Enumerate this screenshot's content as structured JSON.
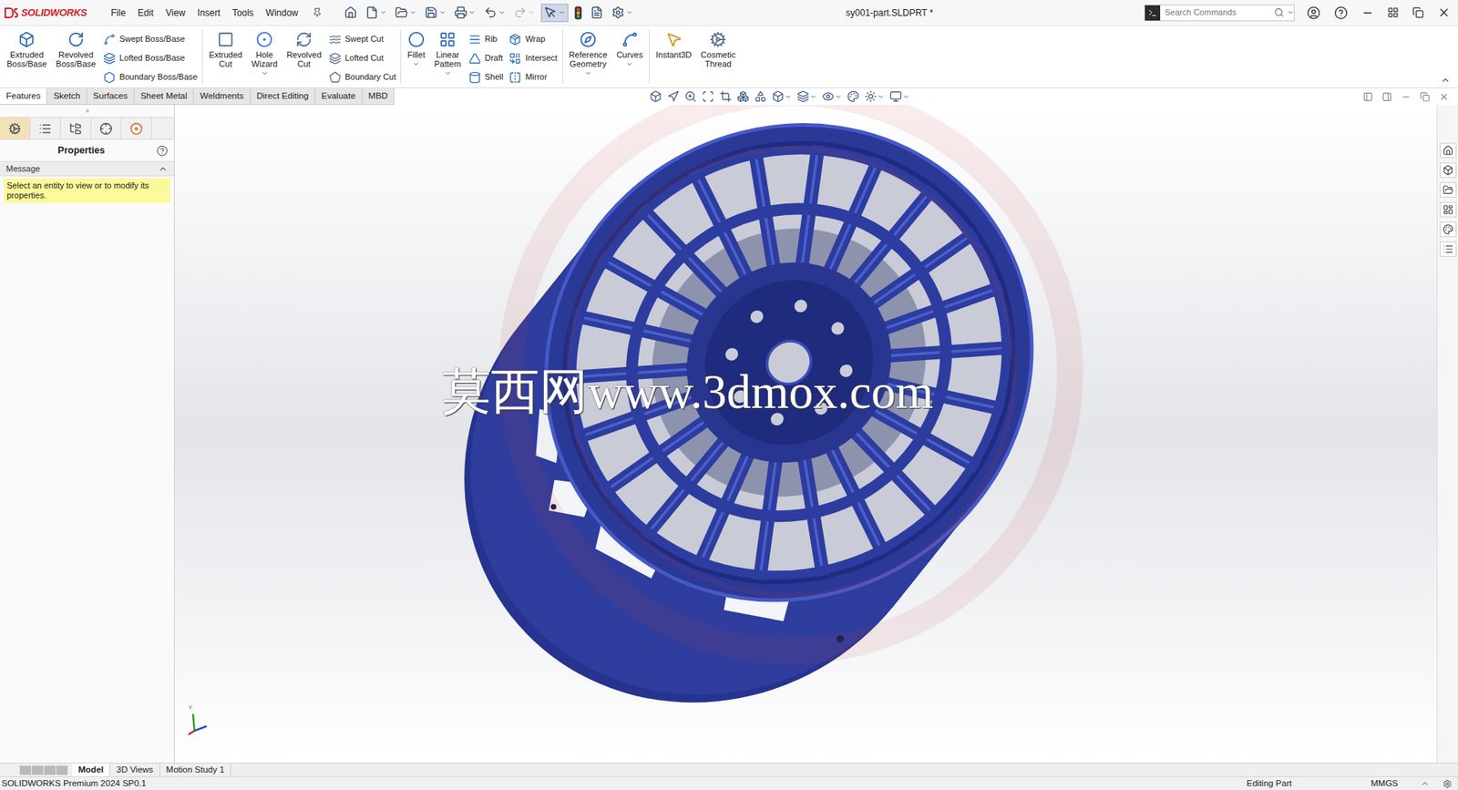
{
  "app": {
    "name": "SOLIDWORKS"
  },
  "menu": [
    "File",
    "Edit",
    "View",
    "Insert",
    "Tools",
    "Window"
  ],
  "toolbar": [
    {
      "dropdown": false,
      "selected": false,
      "disabled": false
    },
    {
      "dropdown": true,
      "selected": false,
      "disabled": false
    },
    {
      "dropdown": true,
      "selected": false,
      "disabled": false
    },
    {
      "dropdown": true,
      "selected": false,
      "disabled": false
    },
    {
      "dropdown": true,
      "selected": false,
      "disabled": false
    },
    {
      "dropdown": true,
      "selected": false,
      "disabled": false
    },
    {
      "dropdown": true,
      "selected": false,
      "disabled": true
    },
    {
      "dropdown": true,
      "selected": true,
      "disabled": false
    },
    {
      "dropdown": false,
      "selected": false,
      "disabled": false
    },
    {
      "dropdown": false,
      "selected": false,
      "disabled": false
    },
    {
      "dropdown": true,
      "selected": false,
      "disabled": false
    }
  ],
  "document": {
    "title": "sy001-part.SLDPRT *"
  },
  "search": {
    "placeholder": "Search Commands"
  },
  "ribbon": {
    "groups": [
      [
        {
          "kind": "large",
          "label": "Extruded Boss/Base",
          "dropdown": false
        },
        {
          "kind": "large",
          "label": "Revolved Boss/Base",
          "dropdown": false
        },
        {
          "kind": "column",
          "items": [
            {
              "label": "Swept Boss/Base"
            },
            {
              "label": "Lofted Boss/Base"
            },
            {
              "label": "Boundary Boss/Base"
            }
          ]
        }
      ],
      [
        {
          "kind": "large",
          "label": "Extruded Cut",
          "dropdown": false
        },
        {
          "kind": "large",
          "label": "Hole Wizard",
          "dropdown": true
        },
        {
          "kind": "large",
          "label": "Revolved Cut",
          "dropdown": false
        },
        {
          "kind": "column",
          "items": [
            {
              "label": "Swept Cut"
            },
            {
              "label": "Lofted Cut"
            },
            {
              "label": "Boundary Cut"
            }
          ]
        }
      ],
      [
        {
          "kind": "large",
          "label": "Fillet",
          "dropdown": true
        },
        {
          "kind": "large",
          "label": "Linear Pattern",
          "dropdown": true
        },
        {
          "kind": "column",
          "items": [
            {
              "label": "Rib"
            },
            {
              "label": "Draft"
            },
            {
              "label": "Shell"
            }
          ]
        },
        {
          "kind": "column",
          "items": [
            {
              "label": "Wrap"
            },
            {
              "label": "Intersect"
            },
            {
              "label": "Mirror"
            }
          ]
        }
      ],
      [
        {
          "kind": "large",
          "label": "Reference Geometry",
          "dropdown": true
        },
        {
          "kind": "large",
          "label": "Curves",
          "dropdown": true
        }
      ],
      [
        {
          "kind": "large",
          "label": "Instant3D",
          "dropdown": false
        },
        {
          "kind": "large",
          "label": "Cosmetic Thread",
          "dropdown": false
        }
      ]
    ]
  },
  "command_tabs": [
    {
      "label": "Features",
      "selected": true
    },
    {
      "label": "Sketch",
      "selected": false
    },
    {
      "label": "Surfaces",
      "selected": false
    },
    {
      "label": "Sheet Metal",
      "selected": false
    },
    {
      "label": "Weldments",
      "selected": false
    },
    {
      "label": "Direct Editing",
      "selected": false
    },
    {
      "label": "Evaluate",
      "selected": false
    },
    {
      "label": "MBD",
      "selected": false
    }
  ],
  "left_panel": {
    "icon_tabs": [
      {
        "selected": true
      },
      {
        "selected": false
      },
      {
        "selected": false
      },
      {
        "selected": false
      },
      {
        "selected": false
      }
    ],
    "title": "Properties",
    "message": {
      "title": "Message",
      "expanded": true,
      "text": "Select an entity to view or to modify its properties."
    }
  },
  "viewport": {
    "watermark": "莫西网www.3dmox.com",
    "triad_label": "Y",
    "heads_up_toolbar": [
      {
        "dropdown": false
      },
      {
        "dropdown": false
      },
      {
        "dropdown": false
      },
      {
        "dropdown": false
      },
      {
        "dropdown": false
      },
      {
        "dropdown": false
      },
      {
        "dropdown": false
      },
      {
        "dropdown": true
      },
      {
        "dropdown": true
      },
      {
        "dropdown": true
      },
      {
        "dropdown": false
      },
      {
        "dropdown": true
      },
      {
        "dropdown": true
      }
    ]
  },
  "bottom_tabs": [
    {
      "label": "Model",
      "selected": true
    },
    {
      "label": "3D Views",
      "selected": false
    },
    {
      "label": "Motion Study 1",
      "selected": false
    }
  ],
  "status_bar": {
    "product": "SOLIDWORKS Premium 2024 SP0.1",
    "mode": "Editing Part",
    "units": "MMGS"
  }
}
